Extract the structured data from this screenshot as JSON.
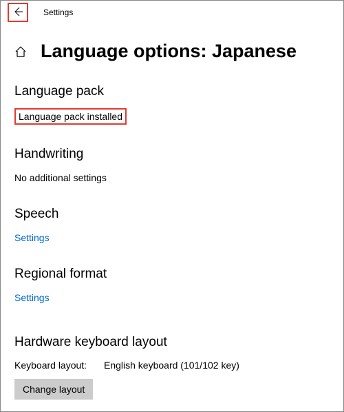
{
  "titlebar": {
    "title": "Settings"
  },
  "header": {
    "page_title": "Language options: Japanese"
  },
  "sections": {
    "language_pack": {
      "heading": "Language pack",
      "status": "Language pack installed"
    },
    "handwriting": {
      "heading": "Handwriting",
      "status": "No additional settings"
    },
    "speech": {
      "heading": "Speech",
      "link": "Settings"
    },
    "regional_format": {
      "heading": "Regional format",
      "link": "Settings"
    },
    "hardware_keyboard": {
      "heading": "Hardware keyboard layout",
      "label": "Keyboard layout:",
      "value": "English keyboard (101/102 key)",
      "button": "Change layout"
    }
  }
}
